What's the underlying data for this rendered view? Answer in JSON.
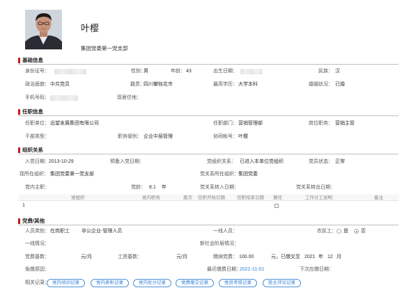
{
  "profile": {
    "name": "叶樱",
    "organization": "集团党委第一党支部"
  },
  "basic": {
    "title": "基础信息",
    "id_number_label": "身份证号：",
    "gender_label": "性别：",
    "gender": "男",
    "age_label": "年龄：",
    "age": "43",
    "birth_date_label": "出生日期：",
    "ethnicity_label": "民族：",
    "ethnicity": "汉",
    "political_label": "政治面貌：",
    "political": "中共党员",
    "native_label": "籍贯：",
    "native": "四川攀枝花市",
    "education_label": "最高学历：",
    "education": "大学本科",
    "marital_label": "婚姻状况：",
    "marital": "已婚",
    "phone_label": "手机号码：",
    "residence_label": "现居住地："
  },
  "job": {
    "title": "任职信息",
    "unit_label": "任职单位：",
    "unit": "远望发展集团有限公司",
    "department_label": "任职部门：",
    "department": "营销管理部",
    "position_label": "岗位职务：",
    "position": "营销主管",
    "cadre_label": "干部类型：",
    "level_label": "职务级别：",
    "level": "企业中层管理",
    "account_label": "协同帐号：",
    "account": "叶樱"
  },
  "org": {
    "title": "组织关系",
    "join_date_label": "入党日期：",
    "join_date": "2013-10-29",
    "probation_label": "预备入党日期：",
    "relation_label": "党组织关系：",
    "relation": "已进入本单位党组织",
    "status_label": "党员状态：",
    "status": "正常",
    "current_org_label": "现所在组织：",
    "current_org": "集团党委第一党支部",
    "relation_org_label": "党关系所在组织：",
    "relation_org": "集团党委",
    "in_party_label": "党内主职：",
    "party_age_label": "党龄：",
    "party_age": "8.1",
    "party_age_unit": "年",
    "transfer_in_label": "党关系转入日期：",
    "transfer_out_label": "党关系转出日期：",
    "table_headers": [
      "党组织",
      "党内职务",
      "届次",
      "任职开始日期",
      "任职结束日期",
      "兼任",
      "工作分工说明",
      "备注"
    ],
    "table_row_index": "1"
  },
  "dues": {
    "title": "党费/其他",
    "category_label": "人员类别：",
    "category_1": "在岗职工",
    "category_2": "非公企业-管理人员",
    "frontline_label": "一线人员：",
    "migrant_label": "农民工：",
    "migrant_yes": "是",
    "migrant_no": "否",
    "frontline_status_label": "一线情况：",
    "new_class_label": "新社会阶层情况：",
    "base_label": "党费基数：",
    "base_unit": "元/月",
    "wage_label": "工资基数：",
    "wage_unit": "元/月",
    "pay_label": "缴纳党费：",
    "pay_value": "100.00",
    "pay_unit_text": "元，已缴交至",
    "pay_year": "2021",
    "pay_year_unit": "年",
    "pay_month": "12",
    "pay_month_unit": "月",
    "exempt_label": "免缴原因：",
    "last_pay_label": "最近缴费日期：",
    "last_pay": "2021-11-01",
    "next_due_label": "下次应缴日期：",
    "records_label": "相关记录：",
    "records": [
      "党内培训记录",
      "党内表彰记录",
      "党内处分记录",
      "党费缴交记录",
      "党员考核记录",
      "民主评议记录"
    ]
  }
}
